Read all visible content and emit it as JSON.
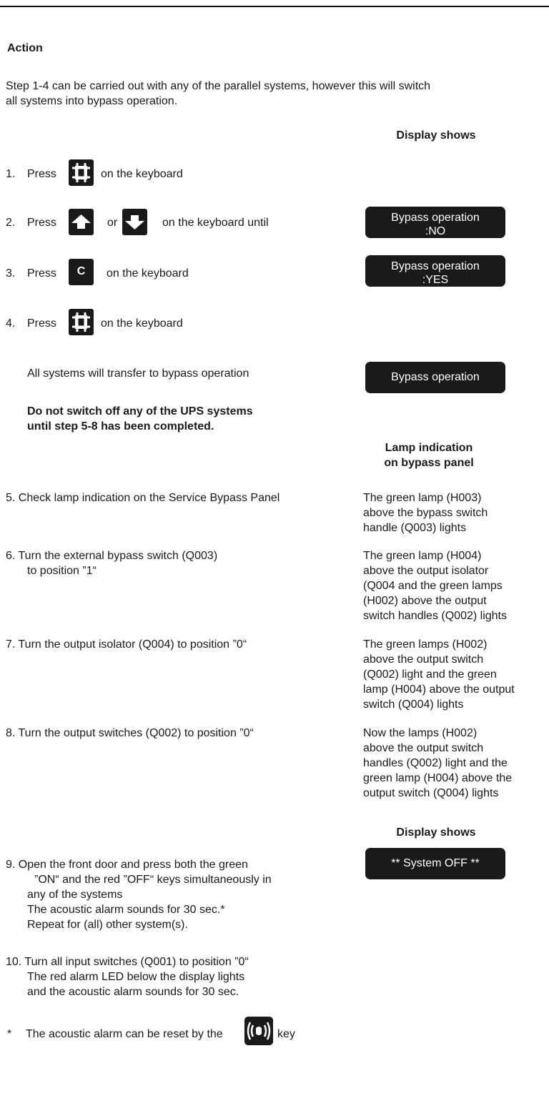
{
  "heading": "Action",
  "intro": [
    "Step 1-4 can be carried out with any of the parallel systems, however this will switch",
    "all systems into bypass operation."
  ],
  "col_header_display": "Display shows",
  "steps": [
    {
      "num": "1.",
      "pre": "Press",
      "post": "on the keyboard"
    },
    {
      "num": "2.",
      "pre": "Press",
      "mid": "or",
      "post": "on the keyboard until"
    },
    {
      "num": "3.",
      "pre": "Press",
      "key_letter": "C",
      "post": "on the keyboard"
    },
    {
      "num": "4.",
      "pre": "Press",
      "post": "on the keyboard"
    }
  ],
  "displays": {
    "d2": [
      "Bypass operation",
      ":NO"
    ],
    "d3": [
      "Bypass operation",
      ":YES"
    ],
    "d4": "Bypass operation",
    "d9": "** System OFF **"
  },
  "transfer_note": "All systems will transfer to bypass operation",
  "warning": [
    "Do not switch off any of the UPS systems",
    "until step 5-8 has been completed."
  ],
  "lamp_header": [
    "Lamp indication",
    "on bypass panel"
  ],
  "steps_b": [
    {
      "text": [
        "5.  Check lamp indication on the Service Bypass Panel"
      ],
      "result": [
        "The green lamp (H003)",
        "above the bypass switch",
        "handle (Q003) lights"
      ]
    },
    {
      "text": [
        "6.  Turn the external bypass switch (Q003)",
        "to position ”1“"
      ],
      "result": [
        "The green lamp (H004)",
        "above the output isolator",
        "(Q004 and the green lamps",
        "(H002) above the output",
        "switch handles (Q002) lights"
      ]
    },
    {
      "text": [
        "7.  Turn the output isolator (Q004) to position ”0“"
      ],
      "result": [
        "The green lamps (H002)",
        "above the output switch",
        "(Q002) light and the green",
        "lamp (H004) above the output",
        "switch (Q004) lights"
      ]
    },
    {
      "text": [
        "8.  Turn the output switches (Q002) to position ”0“"
      ],
      "result": [
        "Now the lamps (H002)",
        "above the output switch",
        "handles (Q002) light and the",
        "green lamp (H004) above the",
        "output switch (Q004) lights"
      ]
    }
  ],
  "col_header_display_2": "Display shows",
  "step9": [
    "9.  Open the front door and press both the green",
    "”ON“ and the red ”OFF“ keys simultaneously in",
    "any of the systems",
    "The acoustic alarm sounds for 30 sec.*",
    "Repeat for (all) other system(s)."
  ],
  "step10": [
    "10. Turn all input switches (Q001) to position ”0“",
    "The red alarm LED below the display lights",
    "and the acoustic alarm sounds for 30 sec."
  ],
  "footnote": {
    "star": "*",
    "pre": "The acoustic alarm can be reset by the",
    "post": "key"
  }
}
